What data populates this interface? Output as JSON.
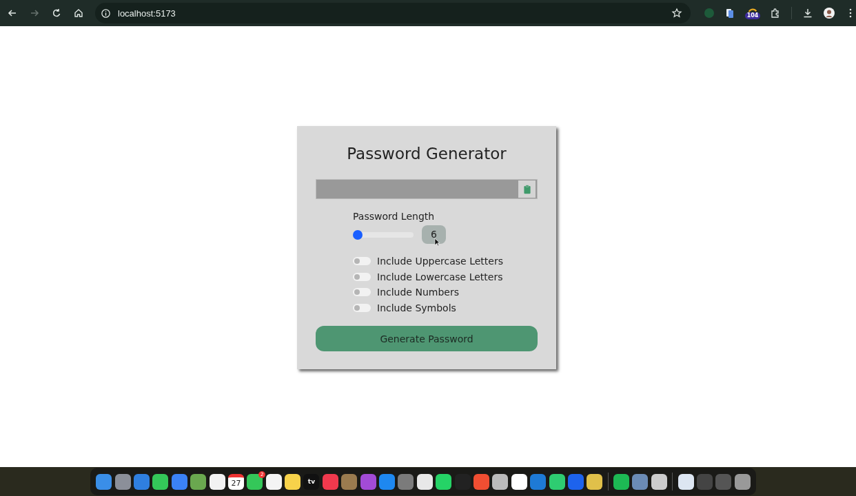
{
  "browser": {
    "url": "localhost:5173",
    "extension_badge": "104"
  },
  "generator": {
    "title": "Password Generator",
    "length": {
      "label": "Password Length",
      "level": 0,
      "value": "6"
    },
    "options": [
      {
        "label": "Include Uppercase Letters",
        "checked": false
      },
      {
        "label": "Include Lowercase Letters",
        "checked": false
      },
      {
        "label": "Include Numbers",
        "checked": false
      },
      {
        "label": "Include Symbols",
        "checked": false
      }
    ],
    "generate_button": "Generate Password"
  },
  "dock": {
    "calendar_day": "27",
    "messages_badge": "2",
    "tv_label": "tv"
  }
}
